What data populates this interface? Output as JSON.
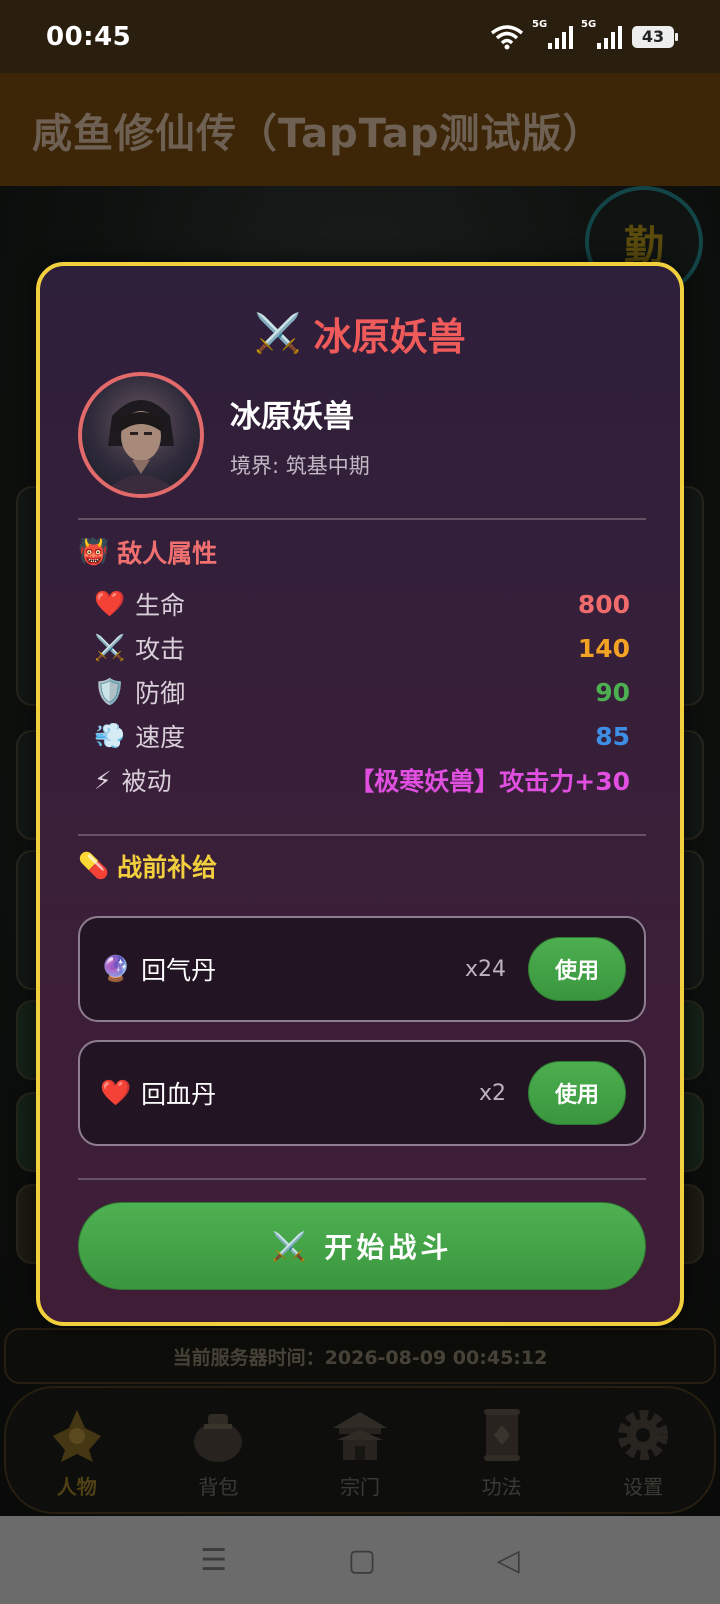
{
  "status_bar": {
    "time": "00:45",
    "network_1": "5G",
    "network_2": "5G",
    "battery": "43"
  },
  "app_bar": {
    "title": "咸鱼修仙传（TapTap测试版）"
  },
  "background": {
    "badge_text": "勤",
    "server_time": "当前服务器时间：2026-08-09 00:45:12"
  },
  "modal": {
    "title": "冰原妖兽",
    "enemy": {
      "name": "冰原妖兽",
      "realm": "境界: 筑基中期"
    },
    "attributes": {
      "heading": "敌人属性",
      "rows": [
        {
          "icon": "❤️",
          "label": "生命",
          "value": "800",
          "color": "#f06b6b"
        },
        {
          "icon": "⚔️",
          "label": "攻击",
          "value": "140",
          "color": "#f3a324"
        },
        {
          "icon": "🛡️",
          "label": "防御",
          "value": "90",
          "color": "#4caf50"
        },
        {
          "icon": "💨",
          "label": "速度",
          "value": "85",
          "color": "#3d8fe6"
        },
        {
          "icon": "⚡",
          "label": "被动",
          "value": "【极寒妖兽】攻击力+30",
          "color": "#e04fe0"
        }
      ]
    },
    "supplies": {
      "heading": "战前补给",
      "items": [
        {
          "icon": "🔮",
          "name": "回气丹",
          "count": "x24",
          "button": "使用"
        },
        {
          "icon": "❤️",
          "name": "回血丹",
          "count": "x2",
          "button": "使用"
        }
      ]
    },
    "start_button": "开始战斗"
  },
  "bottom_nav": [
    {
      "label": "人物",
      "active": true
    },
    {
      "label": "背包",
      "active": false
    },
    {
      "label": "宗门",
      "active": false
    },
    {
      "label": "功法",
      "active": false
    },
    {
      "label": "设置",
      "active": false
    }
  ],
  "system_nav": {
    "menu": "☰",
    "home": "▢",
    "back": "◁"
  },
  "colors": {
    "modal_border": "#f2cf3c",
    "title_red": "#ef5a5a",
    "supply_heading": "#f2cf3c",
    "button_green": "#43a047"
  }
}
